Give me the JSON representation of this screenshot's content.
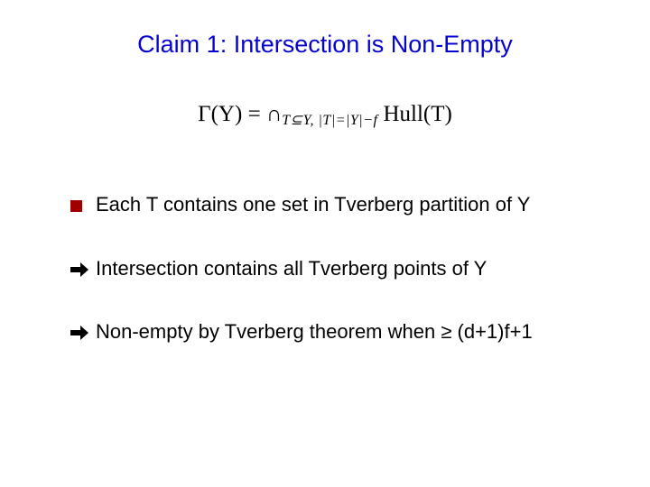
{
  "title": "Claim 1: Intersection is Non-Empty",
  "formula": {
    "lhs": "Γ(Y)",
    "eq": " = ",
    "intersect_sym": "∩",
    "sub_expr": "T⊆Y, |T|=|Y|−f",
    "hull_label": "Hull",
    "hull_arg": "(T)"
  },
  "bullets": [
    {
      "kind": "square",
      "text": "Each T contains one set in Tverberg partition of Y"
    },
    {
      "kind": "arrow",
      "text": "Intersection contains all Tverberg points of Y"
    },
    {
      "kind": "arrow",
      "text": "Non-empty by Tverberg theorem when ≥ (d+1)f+1"
    }
  ]
}
